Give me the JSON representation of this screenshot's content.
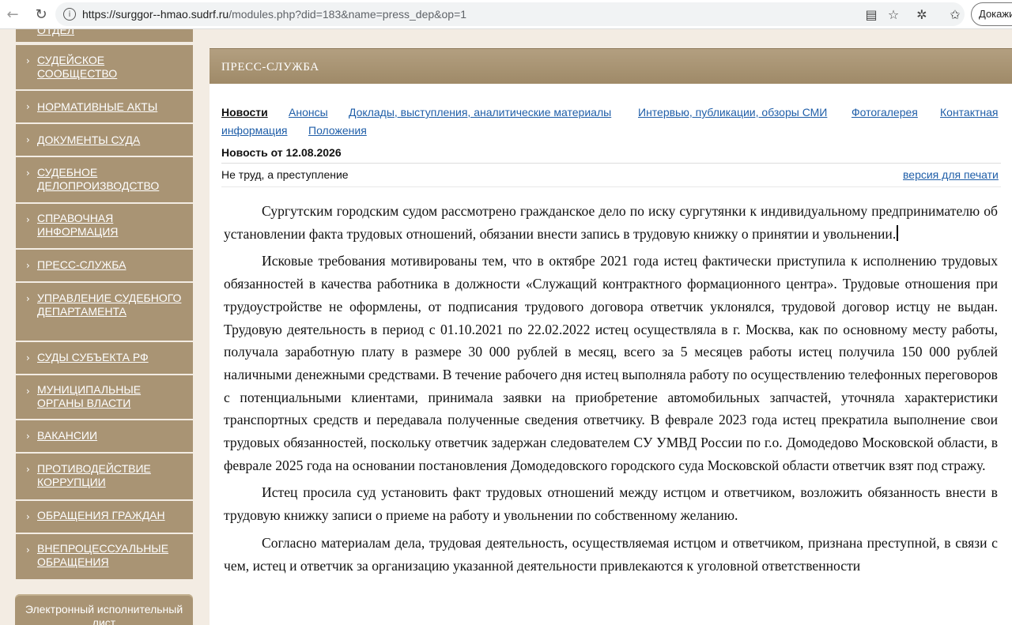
{
  "browser": {
    "url_host": "https://surggor--hmao.sudrf.ru",
    "url_rest": "/modules.php?did=183&name=press_dep&op=1",
    "prove_button": "Докажи"
  },
  "sidebar": {
    "top_partial": "ОТДЕЛ",
    "items": [
      {
        "label": "СУДЕЙСКОЕ СООБЩЕСТВО"
      },
      {
        "label": "НОРМАТИВНЫЕ АКТЫ"
      },
      {
        "label": "ДОКУМЕНТЫ СУДА"
      },
      {
        "label": "СУДЕБНОЕ ДЕЛОПРОИЗВОДСТВО"
      },
      {
        "label": "СПРАВОЧНАЯ ИНФОРМАЦИЯ"
      },
      {
        "label": "ПРЕСС-СЛУЖБА"
      },
      {
        "label": "УПРАВЛЕНИЕ СУДЕБНОГО ДЕПАРТАМЕНТА"
      },
      {
        "label": "СУДЫ СУБЪЕКТА РФ"
      },
      {
        "label": "МУНИЦИПАЛЬНЫЕ ОРГАНЫ ВЛАСТИ"
      },
      {
        "label": "ВАКАНСИИ"
      },
      {
        "label": "ПРОТИВОДЕЙСТВИЕ КОРРУПЦИИ"
      },
      {
        "label": "ОБРАЩЕНИЯ ГРАЖДАН"
      },
      {
        "label": "ВНЕПРОЦЕССУАЛЬНЫЕ ОБРАЩЕНИЯ"
      }
    ],
    "exec_box": "Электронный исполнительный лист"
  },
  "header": {
    "title": "ПРЕСС-СЛУЖБА"
  },
  "tabs": [
    {
      "label": "Новости"
    },
    {
      "label": "Анонсы"
    },
    {
      "label": "Доклады, выступления, аналитические материалы"
    },
    {
      "label": "Интервью, публикации, обзоры СМИ"
    },
    {
      "label": "Фотогалерея"
    },
    {
      "label": "Контактная"
    },
    {
      "label": "информация"
    },
    {
      "label": "Положения"
    }
  ],
  "news": {
    "date_label": "Новость от 12.08.2026",
    "title": "Не труд, а преступление",
    "print_link": "версия для печати",
    "paragraphs": [
      "Сургутским городским судом рассмотрено гражданское дело по иску сургутянки к индивидуальному предпринимателю об установлении факта трудовых отношений, обязании внести запись в трудовую книжку о принятии и увольнении.",
      "Исковые требования мотивированы тем, что в октябре 2021 года истец фактически приступила к исполнению трудовых обязанностей в качества работника в должности «Служащий контрактного формационного центра». Трудовые отношения при трудоустройстве не оформлены, от подписания трудового договора ответчик уклонялся, трудовой договор истцу не выдан. Трудовую деятельность в период с 01.10.2021 по 22.02.2022 истец осуществляла в г. Москва, как по основному месту работы, получала заработную плату в размере 30 000 рублей в месяц, всего за 5 месяцев работы истец получила 150 000 рублей наличными денежными средствами. В течение рабочего дня истец выполняла работу по осуществлению телефонных переговоров с потенциальными клиентами, принимала заявки на приобретение автомобильных запчастей, уточняла характеристики транспортных средств и передавала полученные сведения ответчику. В феврале 2023 года истец прекратила выполнение свои трудовых обязанностей, поскольку ответчик задержан следователем СУ УМВД России по г.о. Домодедово Московской области, в феврале 2025 года на основании постановления Домодедовского городского суда Московской области ответчик взят под стражу.",
      "Истец просила суд установить факт трудовых отношений между истцом и ответчиком, возложить обязанность внести в трудовую книжку записи о приеме на работу и увольнении по собственному желанию.",
      "Согласно материалам дела, трудовая деятельность, осуществляемая истцом и ответчиком, признана преступной, в связи с чем, истец и ответчик за организацию указанной деятельности привлекаются  к уголовной ответственности"
    ]
  }
}
